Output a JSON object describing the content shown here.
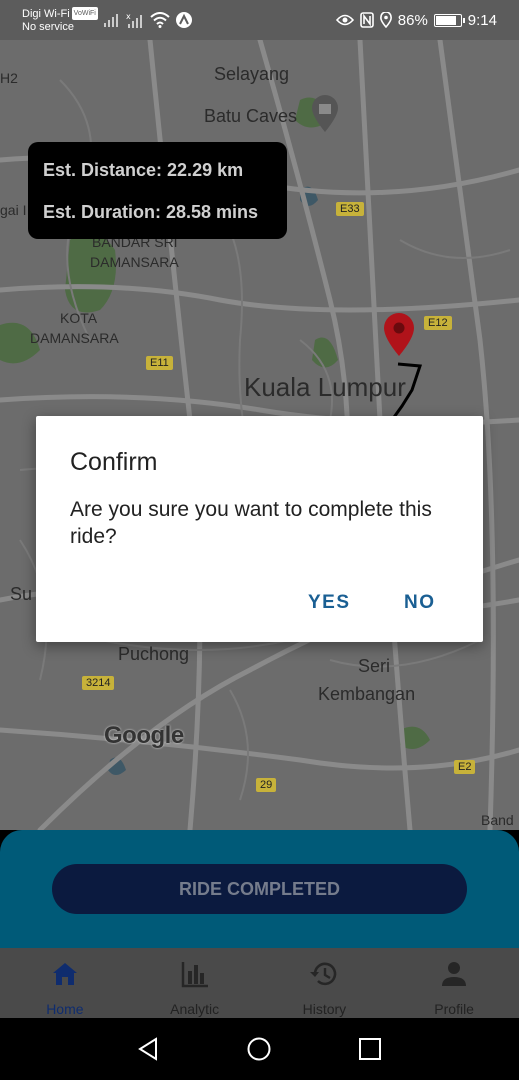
{
  "status_bar": {
    "carrier": "Digi Wi-Fi",
    "vowifi": "VoWiFi",
    "service": "No service",
    "battery": "86%",
    "battery_level": 0.86,
    "time": "9:14"
  },
  "map": {
    "places": [
      {
        "name": "Selayang",
        "size": "normal"
      },
      {
        "name": "Batu Caves",
        "size": "normal"
      },
      {
        "name": "BANDAR SRI",
        "size": "small"
      },
      {
        "name": "DAMANSARA",
        "size": "small"
      },
      {
        "name": "KOTA",
        "size": "small"
      },
      {
        "name": "DAMANSARA",
        "size": "small"
      },
      {
        "name": "Kuala Lumpur",
        "size": "big"
      },
      {
        "name": "Puchong",
        "size": "normal"
      },
      {
        "name": "Seri",
        "size": "normal"
      },
      {
        "name": "Kembangan",
        "size": "normal"
      },
      {
        "name": "Su",
        "size": "normal"
      },
      {
        "name": "Band",
        "size": "small"
      },
      {
        "name": "gai I",
        "size": "small"
      },
      {
        "name": "H2",
        "size": "small"
      }
    ],
    "road_shields": [
      "E33",
      "E12",
      "E11",
      "3214",
      "29",
      "E2"
    ],
    "logo": "Google",
    "marker_icon": "location-pin-icon",
    "marker_color": "#b0131a"
  },
  "estimate": {
    "distance": "Est. Distance: 22.29 km",
    "duration": "Est. Duration: 28.58 mins"
  },
  "dialog": {
    "title": "Confirm",
    "message": "Are you sure you want to complete this ride?",
    "yes_label": "YES",
    "no_label": "NO"
  },
  "ride_panel": {
    "button_label": "RIDE COMPLETED"
  },
  "tabs": [
    {
      "label": "Home",
      "icon": "home-icon",
      "active": true
    },
    {
      "label": "Analytic",
      "icon": "bar-chart-icon",
      "active": false
    },
    {
      "label": "History",
      "icon": "history-icon",
      "active": false
    },
    {
      "label": "Profile",
      "icon": "person-icon",
      "active": false
    }
  ],
  "colors": {
    "accent": "#1a5f93",
    "panel": "#005a78",
    "button": "#0b1a3f"
  }
}
